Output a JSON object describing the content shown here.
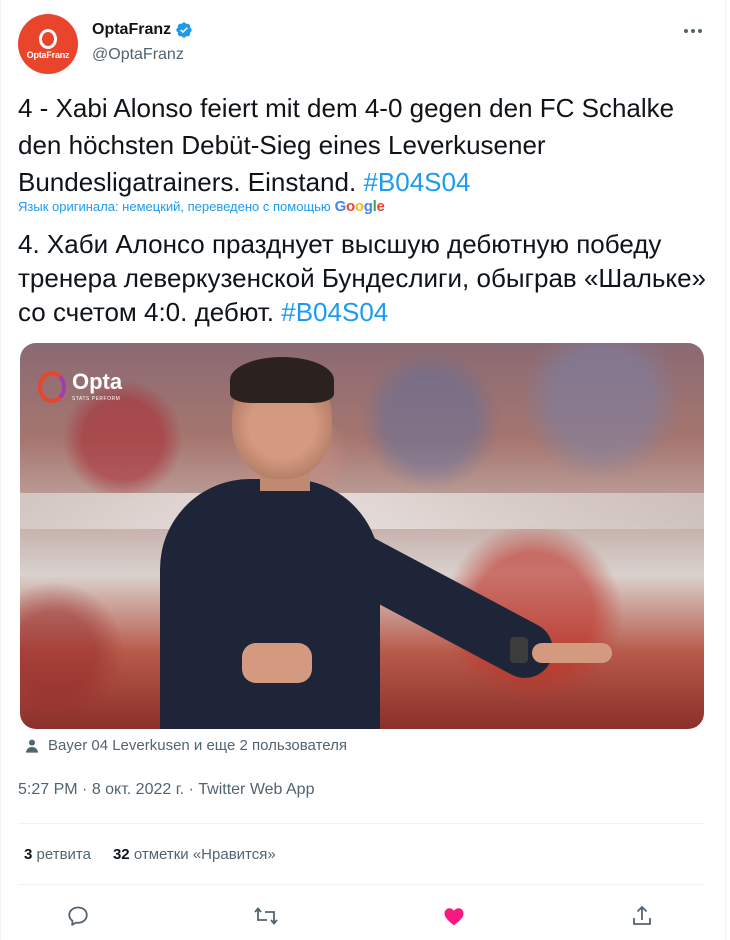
{
  "author": {
    "display_name": "OptaFranz",
    "handle": "@OptaFranz",
    "avatar_text": "OptaFranz",
    "verified": true
  },
  "tweet": {
    "text_main": "4 - Xabi Alonso feiert mit dem 4-0 gegen den FC Schalke den höchsten Debüt-Sieg eines Leverkusener Bundesligatrainers. Einstand.",
    "hashtag": "#B04S04",
    "translation_note": "Язык оригинала: немецкий, переведено с помощью",
    "google": [
      "G",
      "o",
      "o",
      "g",
      "l",
      "e"
    ],
    "translated_main": "4. Хаби Алонсо празднует высшую дебютную победу тренера леверкузенской Бундеслиги, обыграв «Шальке» со счетом 4:0. дебют.",
    "translated_hashtag": "#B04S04"
  },
  "media": {
    "watermark": "Opta",
    "watermark_sub": "STATS PERFORM"
  },
  "tagged": "Bayer 04 Leverkusen и еще 2 пользователя",
  "meta": {
    "time": "5:27 PM",
    "sep1": " · ",
    "date": "8 окт. 2022 г.",
    "sep2": " · ",
    "source": "Twitter Web App"
  },
  "stats": {
    "retweets_count": "3",
    "retweets_label": " ретвита",
    "likes_count": "32",
    "likes_label": " отметки «Нравится»"
  },
  "colors": {
    "accent": "#1d9bf0",
    "like": "#f91880",
    "secondary_text": "#536471"
  },
  "icons": [
    "verified-badge-icon",
    "more-icon",
    "tag-user-icon",
    "reply-icon",
    "retweet-icon",
    "like-icon",
    "share-icon"
  ]
}
